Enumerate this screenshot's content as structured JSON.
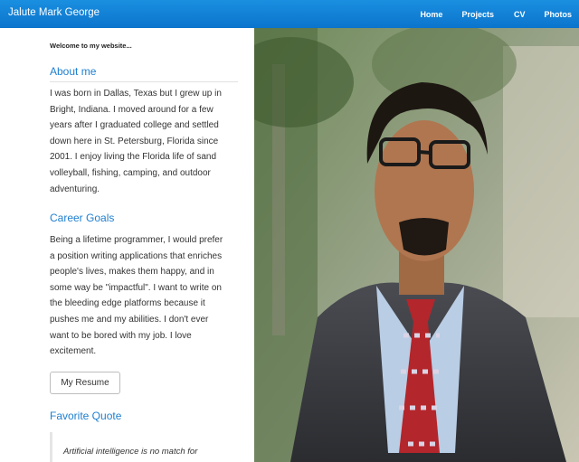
{
  "brand": "Jalute Mark George",
  "nav": {
    "home": "Home",
    "projects": "Projects",
    "cv": "CV",
    "photos": "Photos"
  },
  "welcome": "Welcome to my website...",
  "about": {
    "title": "About me",
    "lines": [
      "I was born in Dallas, Texas but I grew up in",
      "Bright, Indiana. I moved around for a few",
      "years after I graduated college and settled",
      "down here in St. Petersburg, Florida since",
      "2001. I enjoy living the Florida life of sand",
      "volleyball, fishing, camping, and outdoor",
      "adventuring."
    ]
  },
  "career": {
    "title": "Career Goals",
    "lines": [
      "Being a lifetime programmer, I would prefer",
      "a position writing applications that enriches",
      "people's lives, makes them happy, and in",
      "some way be \"impactful\". I want to write on",
      "the bleeding edge platforms because it",
      "pushes me and my abilities. I don't ever",
      "want to be bored with my job. I love",
      "excitement."
    ]
  },
  "resume_button": "My Resume",
  "quote": {
    "title": "Favorite Quote",
    "text": "Artificial intelligence is no match for"
  },
  "colors": {
    "navbar": "#0b74cc",
    "accent": "#1e7fd0"
  }
}
